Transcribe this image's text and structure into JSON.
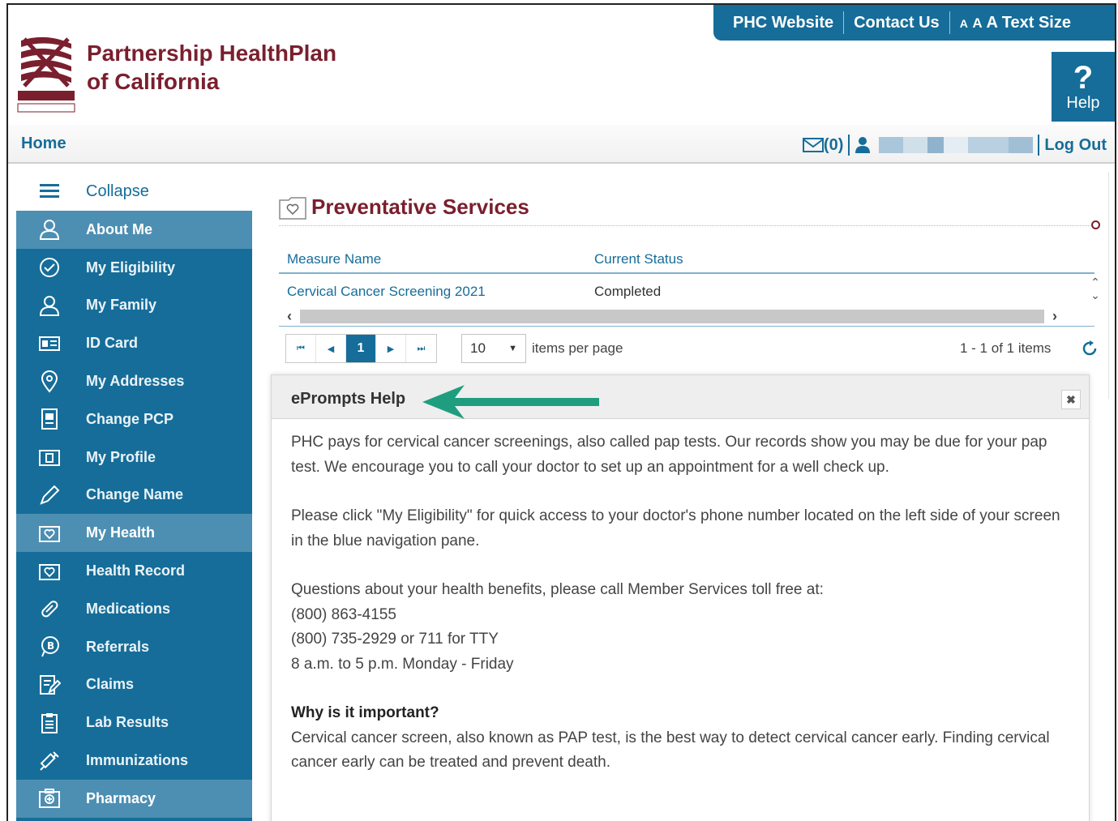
{
  "brand": {
    "title_line1": "Partnership HealthPlan",
    "title_line2": "of California",
    "color": "#7a1f2e"
  },
  "top_nav": {
    "website": "PHC Website",
    "contact": "Contact Us",
    "text_size_a1": "A",
    "text_size_a2": "A",
    "text_size_a3": "A",
    "text_size_label": "Text Size",
    "color": "#166d99"
  },
  "help": {
    "glyph": "?",
    "label": "Help"
  },
  "subbar": {
    "home": "Home",
    "messages": "(0)",
    "logout": "Log Out"
  },
  "sidebar": {
    "collapse": "Collapse",
    "items": [
      {
        "label": "About Me",
        "icon": "person-icon",
        "active": true
      },
      {
        "label": "My Eligibility",
        "icon": "check-circle-icon",
        "active": false
      },
      {
        "label": "My Family",
        "icon": "person-icon",
        "active": false
      },
      {
        "label": "ID Card",
        "icon": "id-card-icon",
        "active": false
      },
      {
        "label": "My Addresses",
        "icon": "map-pin-icon",
        "active": false
      },
      {
        "label": "Change PCP",
        "icon": "document-icon",
        "active": false
      },
      {
        "label": "My Profile",
        "icon": "profile-folder-icon",
        "active": false
      },
      {
        "label": "Change Name",
        "icon": "pencil-icon",
        "active": false
      },
      {
        "label": "My Health",
        "icon": "heart-folder-icon",
        "active": true
      },
      {
        "label": "Health Record",
        "icon": "heart-folder-icon",
        "active": false
      },
      {
        "label": "Medications",
        "icon": "pill-icon",
        "active": false
      },
      {
        "label": "Referrals",
        "icon": "chat-bubble-icon",
        "active": false
      },
      {
        "label": "Claims",
        "icon": "edit-document-icon",
        "active": false
      },
      {
        "label": "Lab Results",
        "icon": "clipboard-icon",
        "active": false
      },
      {
        "label": "Immunizations",
        "icon": "syringe-icon",
        "active": false
      },
      {
        "label": "Pharmacy",
        "icon": "pharmacy-icon",
        "active": true
      }
    ]
  },
  "panel": {
    "title": "Preventative Services",
    "columns": [
      "Measure Name",
      "Current Status"
    ],
    "rows": [
      {
        "measure": "Cervical Cancer Screening 2021",
        "status": "Completed"
      }
    ],
    "pager": {
      "current_page": "1",
      "page_size": "10",
      "per_page_label": "items per page",
      "info": "1 - 1 of 1 items"
    }
  },
  "eprompts": {
    "title": "ePrompts Help",
    "p1": "PHC pays for cervical cancer screenings, also called pap tests. Our records show you may be due for your pap test. We encourage you to call your doctor to set up an appointment for a well check up.",
    "p2": "Please click \"My Eligibility\" for quick access to your doctor's phone number located on the left side of your screen in the blue navigation pane.",
    "p3_line1": "Questions about your health benefits, please call Member Services toll free at:",
    "p3_line2": "(800) 863-4155",
    "p3_line3": "(800) 735-2929 or 711 for TTY",
    "p3_line4": "8 a.m. to 5 p.m. Monday - Friday",
    "why_title": "Why is it important?",
    "why_text": "Cervical cancer screen, also known as PAP test, is the best way to detect cervical cancer early. Finding cervical cancer early can be treated and prevent death.",
    "arrow_color": "#1f9e7f"
  }
}
